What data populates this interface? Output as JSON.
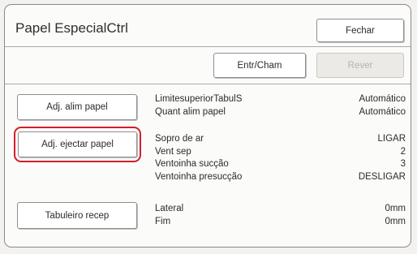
{
  "header": {
    "title": "Papel EspecialCtrl",
    "close_label": "Fechar"
  },
  "toolbar": {
    "entr_cham_label": "Entr/Cham",
    "rever_label": "Rever"
  },
  "sections": {
    "alim": {
      "button_label": "Adj. alim papel",
      "rows": [
        {
          "label": "LimitesuperiorTabulS",
          "value": "Automático"
        },
        {
          "label": "Quant alim papel",
          "value": "Automático"
        }
      ]
    },
    "ejectar": {
      "button_label": "Adj. ejectar papel",
      "rows": [
        {
          "label": "Sopro de ar",
          "value": "LIGAR"
        },
        {
          "label": "Vent sep",
          "value": "2"
        },
        {
          "label": "Ventoinha sucção",
          "value": "3"
        },
        {
          "label": "Ventoinha presucção",
          "value": "DESLIGAR"
        }
      ]
    },
    "recep": {
      "button_label": "Tabuleiro recep",
      "rows": [
        {
          "label": "Lateral",
          "value": "0mm"
        },
        {
          "label": "Fim",
          "value": "0mm"
        }
      ]
    }
  },
  "colors": {
    "highlight": "#d51d2a",
    "disabled_text": "#b4b2ad"
  }
}
